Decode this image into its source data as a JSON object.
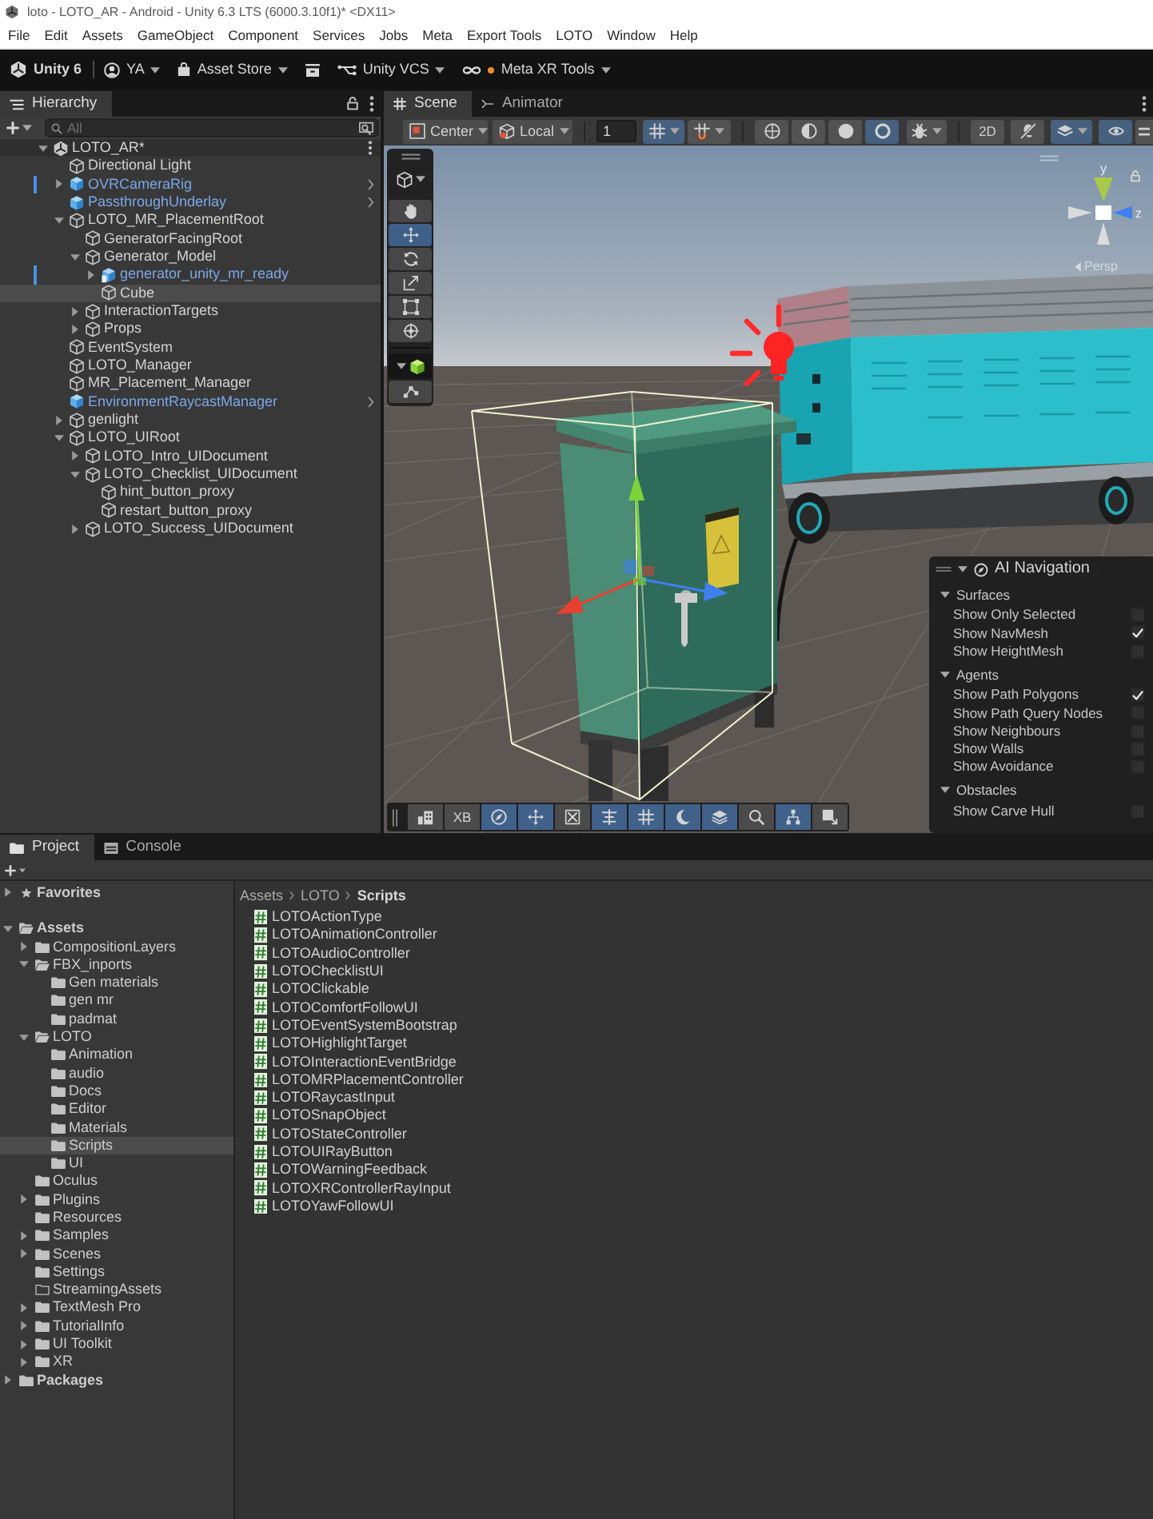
{
  "window": {
    "title": "loto - LOTO_AR - Android - Unity 6.3 LTS (6000.3.10f1)* <DX11>"
  },
  "menu": [
    "File",
    "Edit",
    "Assets",
    "GameObject",
    "Component",
    "Services",
    "Jobs",
    "Meta",
    "Export Tools",
    "LOTO",
    "Window",
    "Help"
  ],
  "main_toolbar": [
    {
      "kind": "product",
      "label": "Unity 6"
    },
    {
      "kind": "account",
      "label": "YA"
    },
    {
      "kind": "store",
      "label": "Asset Store"
    },
    {
      "kind": "icon"
    },
    {
      "kind": "vcs",
      "label": "Unity VCS"
    },
    {
      "kind": "tools",
      "label": "Meta XR Tools"
    }
  ],
  "hierarchy": {
    "tab": {
      "label": "Hierarchy",
      "selected": true
    },
    "search": {
      "placeholder": "All"
    },
    "tree": [
      {
        "name": "LOTO_AR*",
        "kind": "scene",
        "expanded": true,
        "selected": false,
        "overridden": false,
        "children": [
          {
            "name": "Directional Light",
            "kind": "object",
            "selected": false,
            "overridden": false
          },
          {
            "name": "OVRCameraRig",
            "kind": "prefab",
            "expanded": false,
            "selected": false,
            "overridden": true
          },
          {
            "name": "PassthroughUnderlay",
            "kind": "prefab",
            "selected": false,
            "overridden": false
          },
          {
            "name": "LOTO_MR_PlacementRoot",
            "kind": "object",
            "expanded": true,
            "selected": false,
            "overridden": false,
            "children": [
              {
                "name": "GeneratorFacingRoot",
                "kind": "object",
                "selected": false,
                "overridden": false
              },
              {
                "name": "Generator_Model",
                "kind": "object",
                "expanded": true,
                "selected": false,
                "overridden": false,
                "children": [
                  {
                    "name": "generator_unity_mr_ready",
                    "kind": "model",
                    "expanded": false,
                    "selected": false,
                    "overridden": true
                  },
                  {
                    "name": "Cube",
                    "kind": "object",
                    "selected": true,
                    "overridden": false
                  }
                ]
              },
              {
                "name": "InteractionTargets",
                "kind": "object",
                "expanded": false,
                "selected": false,
                "overridden": false
              },
              {
                "name": "Props",
                "kind": "object",
                "expanded": false,
                "selected": false,
                "overridden": false
              }
            ]
          },
          {
            "name": "EventSystem",
            "kind": "object",
            "selected": false,
            "overridden": false
          },
          {
            "name": "LOTO_Manager",
            "kind": "object",
            "selected": false,
            "overridden": false
          },
          {
            "name": "MR_Placement_Manager",
            "kind": "object",
            "selected": false,
            "overridden": false
          },
          {
            "name": "EnvironmentRaycastManager",
            "kind": "prefab",
            "selected": false,
            "overridden": false
          },
          {
            "name": "genlight",
            "kind": "object",
            "expanded": false,
            "selected": false,
            "overridden": false
          },
          {
            "name": "LOTO_UIRoot",
            "kind": "object",
            "expanded": true,
            "selected": false,
            "overridden": false,
            "children": [
              {
                "name": "LOTO_Intro_UIDocument",
                "kind": "object",
                "expanded": false,
                "selected": false,
                "overridden": false
              },
              {
                "name": "LOTO_Checklist_UIDocument",
                "kind": "object",
                "expanded": true,
                "selected": false,
                "overridden": false,
                "children": [
                  {
                    "name": "hint_button_proxy",
                    "kind": "object",
                    "selected": false,
                    "overridden": false
                  },
                  {
                    "name": "restart_button_proxy",
                    "kind": "object",
                    "selected": false,
                    "overridden": false
                  }
                ]
              },
              {
                "name": "LOTO_Success_UIDocument",
                "kind": "object",
                "expanded": false,
                "selected": false,
                "overridden": false
              }
            ]
          }
        ]
      }
    ]
  },
  "scene_view": {
    "tabs": [
      {
        "label": "Scene",
        "selected": true
      },
      {
        "label": "Animator",
        "selected": false
      }
    ],
    "toolbar": [
      {
        "kind": "pivot",
        "label": "Center"
      },
      {
        "kind": "space",
        "label": "Local"
      },
      {
        "kind": "field",
        "value": "1"
      },
      {
        "kind": "grid_snap",
        "on": true
      },
      {
        "kind": "increment_snap",
        "on": false
      },
      {
        "kind": "wireframe",
        "on": false
      },
      {
        "kind": "shaded_wireframe",
        "on": false
      },
      {
        "kind": "shaded",
        "on": false
      },
      {
        "kind": "unlit",
        "on": true
      },
      {
        "kind": "gizmos",
        "on": false
      },
      {
        "kind": "mode_2d",
        "label": "2D",
        "on": false
      },
      {
        "kind": "lighting",
        "on": false
      },
      {
        "kind": "effects",
        "on": true
      },
      {
        "kind": "visibility",
        "on": true
      },
      {
        "kind": "more",
        "on": false
      }
    ],
    "tools": [
      {
        "kind": "hand",
        "selected": false
      },
      {
        "kind": "move",
        "selected": true
      },
      {
        "kind": "rotate",
        "selected": false
      },
      {
        "kind": "scale",
        "selected": false
      },
      {
        "kind": "rect",
        "selected": false
      },
      {
        "kind": "transform",
        "selected": false
      }
    ],
    "orientation_gizmo": {
      "axes": [
        "y",
        "z"
      ],
      "projection": "Persp"
    },
    "ai_navigation": {
      "title": "AI Navigation",
      "expanded": true,
      "sections": [
        {
          "title": "Surfaces",
          "expanded": true,
          "options": [
            {
              "label": "Show Only Selected",
              "checked": false
            },
            {
              "label": "Show NavMesh",
              "checked": true
            },
            {
              "label": "Show HeightMesh",
              "checked": false
            }
          ]
        },
        {
          "title": "Agents",
          "expanded": true,
          "options": [
            {
              "label": "Show Path Polygons",
              "checked": true
            },
            {
              "label": "Show Path Query Nodes",
              "checked": false
            },
            {
              "label": "Show Neighbours",
              "checked": false
            },
            {
              "label": "Show Walls",
              "checked": false
            },
            {
              "label": "Show Avoidance",
              "checked": false
            }
          ]
        },
        {
          "title": "Obstacles",
          "expanded": true,
          "options": [
            {
              "label": "Show Carve Hull",
              "checked": false
            }
          ]
        }
      ]
    },
    "overlay_toolbar": [
      {
        "kind": "buildings",
        "on": false
      },
      {
        "kind": "text",
        "label": "XB",
        "on": false
      },
      {
        "kind": "compass",
        "on": true
      },
      {
        "kind": "move",
        "on": true
      },
      {
        "kind": "cross",
        "on": false
      },
      {
        "kind": "align",
        "on": true
      },
      {
        "kind": "grid",
        "on": true
      },
      {
        "kind": "crescent",
        "on": true
      },
      {
        "kind": "layers",
        "on": true
      },
      {
        "kind": "zoom",
        "on": false
      },
      {
        "kind": "network",
        "on": true
      },
      {
        "kind": "export",
        "on": false
      }
    ]
  },
  "project": {
    "tabs": [
      {
        "label": "Project",
        "selected": true
      },
      {
        "label": "Console",
        "selected": false
      }
    ],
    "tree": [
      {
        "name": "Favorites",
        "kind": "favorites",
        "expanded": false,
        "selected": false
      },
      {
        "name": "Assets",
        "kind": "root",
        "expanded": true,
        "selected": false,
        "children": [
          {
            "name": "CompositionLayers",
            "kind": "folder",
            "expanded": false,
            "selected": false
          },
          {
            "name": "FBX_inports",
            "kind": "folder",
            "expanded": true,
            "selected": false,
            "children": [
              {
                "name": "Gen materials",
                "kind": "folder",
                "selected": false
              },
              {
                "name": "gen mr",
                "kind": "folder",
                "selected": false
              },
              {
                "name": "padmat",
                "kind": "folder",
                "selected": false
              }
            ]
          },
          {
            "name": "LOTO",
            "kind": "folder",
            "expanded": true,
            "selected": false,
            "children": [
              {
                "name": "Animation",
                "kind": "folder",
                "selected": false
              },
              {
                "name": "audio",
                "kind": "folder",
                "selected": false
              },
              {
                "name": "Docs",
                "kind": "folder",
                "selected": false
              },
              {
                "name": "Editor",
                "kind": "folder",
                "selected": false
              },
              {
                "name": "Materials",
                "kind": "folder",
                "selected": false
              },
              {
                "name": "Scripts",
                "kind": "folder",
                "selected": true
              },
              {
                "name": "UI",
                "kind": "folder",
                "selected": false
              }
            ]
          },
          {
            "name": "Oculus",
            "kind": "folder",
            "selected": false
          },
          {
            "name": "Plugins",
            "kind": "folder",
            "expanded": false,
            "selected": false
          },
          {
            "name": "Resources",
            "kind": "folder",
            "selected": false
          },
          {
            "name": "Samples",
            "kind": "folder",
            "expanded": false,
            "selected": false
          },
          {
            "name": "Scenes",
            "kind": "folder",
            "expanded": false,
            "selected": false
          },
          {
            "name": "Settings",
            "kind": "folder",
            "selected": false
          },
          {
            "name": "StreamingAssets",
            "kind": "empty_folder",
            "selected": false
          },
          {
            "name": "TextMesh Pro",
            "kind": "folder",
            "expanded": false,
            "selected": false
          },
          {
            "name": "TutorialInfo",
            "kind": "folder",
            "expanded": false,
            "selected": false
          },
          {
            "name": "UI Toolkit",
            "kind": "folder",
            "expanded": false,
            "selected": false
          },
          {
            "name": "XR",
            "kind": "folder",
            "expanded": false,
            "selected": false
          }
        ]
      },
      {
        "name": "Packages",
        "kind": "root",
        "expanded": false,
        "selected": false
      }
    ],
    "breadcrumb": [
      "Assets",
      "LOTO",
      "Scripts"
    ],
    "files": [
      "LOTOActionType",
      "LOTOAnimationController",
      "LOTOAudioController",
      "LOTOChecklistUI",
      "LOTOClickable",
      "LOTOComfortFollowUI",
      "LOTOEventSystemBootstrap",
      "LOTOHighlightTarget",
      "LOTOInteractionEventBridge",
      "LOTOMRPlacementController",
      "LOTORaycastInput",
      "LOTOSnapObject",
      "LOTOStateController",
      "LOTOUIRayButton",
      "LOTOWarningFeedback",
      "LOTOXRControllerRayInput",
      "LOTOYawFollowUI"
    ]
  }
}
